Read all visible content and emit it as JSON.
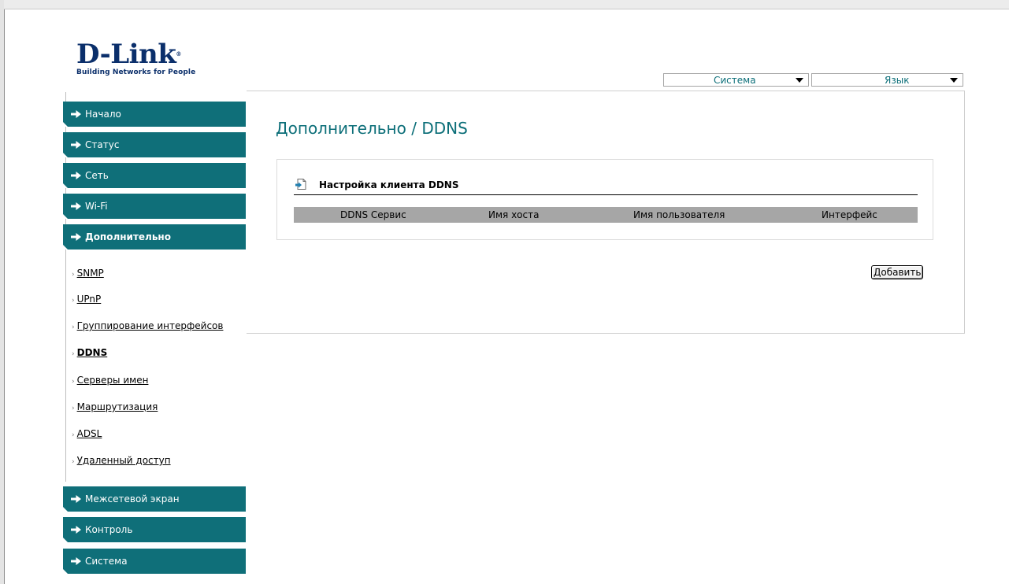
{
  "logo": {
    "brand": "D-Link",
    "registered": "®",
    "tagline": "Building Networks for People"
  },
  "top_selects": {
    "system": "Система",
    "language": "Язык"
  },
  "sidebar": {
    "items_top": [
      {
        "label": "Начало"
      },
      {
        "label": "Статус"
      },
      {
        "label": "Сеть"
      },
      {
        "label": "Wi-Fi"
      },
      {
        "label": "Дополнительно",
        "active": true
      }
    ],
    "submenu": [
      {
        "label": "SNMP"
      },
      {
        "label": "UPnP"
      },
      {
        "label": "Группирование интерфейсов"
      },
      {
        "label": "DDNS",
        "active": true
      },
      {
        "label": "Серверы имен"
      },
      {
        "label": "Маршрутизация"
      },
      {
        "label": "ADSL"
      },
      {
        "label": "Удаленный доступ"
      }
    ],
    "items_bottom": [
      {
        "label": "Межсетевой экран"
      },
      {
        "label": "Контроль"
      },
      {
        "label": "Система"
      }
    ],
    "submenu_bullet": "›"
  },
  "main": {
    "page_title": "Дополнительно / DDNS",
    "section_title": "Настройка клиента DDNS",
    "table_columns": [
      "DDNS Сервис",
      "Имя хоста",
      "Имя пользователя",
      "Интерфейс"
    ],
    "add_button_label": "Добавить"
  },
  "colors": {
    "accent": "#0f6f79",
    "title": "#0b6e78",
    "logo": "#0b2f6b",
    "table_header": "#a6a6a6"
  }
}
